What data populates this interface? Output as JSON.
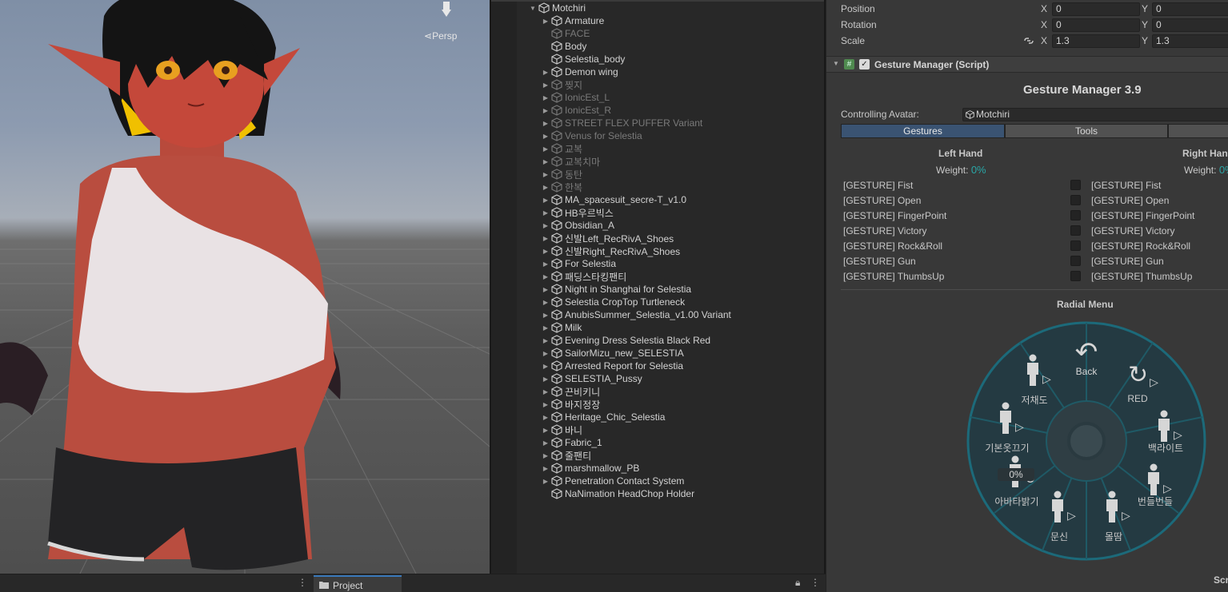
{
  "scene": {
    "persp_label": "Persp"
  },
  "hierarchy": {
    "root": "Motchiri",
    "items": [
      {
        "label": "Armature",
        "expandable": true,
        "active": true
      },
      {
        "label": "FACE",
        "expandable": false,
        "active": false
      },
      {
        "label": "Body",
        "expandable": false,
        "active": true
      },
      {
        "label": "Selestia_body",
        "expandable": false,
        "active": true
      },
      {
        "label": "Demon wing",
        "expandable": true,
        "active": true
      },
      {
        "label": "찢지",
        "expandable": true,
        "active": false
      },
      {
        "label": "IonicEst_L",
        "expandable": true,
        "active": false
      },
      {
        "label": "IonicEst_R",
        "expandable": true,
        "active": false
      },
      {
        "label": "STREET FLEX PUFFER Variant",
        "expandable": true,
        "active": false
      },
      {
        "label": "Venus for Selestia",
        "expandable": true,
        "active": false
      },
      {
        "label": "교복",
        "expandable": true,
        "active": false
      },
      {
        "label": "교복치마",
        "expandable": true,
        "active": false
      },
      {
        "label": "동탄",
        "expandable": true,
        "active": false
      },
      {
        "label": "한복",
        "expandable": true,
        "active": false
      },
      {
        "label": "MA_spacesuit_secre-T_v1.0",
        "expandable": true,
        "active": true
      },
      {
        "label": "HB우르빅스",
        "expandable": true,
        "active": true
      },
      {
        "label": "Obsidian_A",
        "expandable": true,
        "active": true
      },
      {
        "label": "신발Left_RecRivA_Shoes",
        "expandable": true,
        "active": true
      },
      {
        "label": "신발Right_RecRivA_Shoes",
        "expandable": true,
        "active": true
      },
      {
        "label": "For Selestia",
        "expandable": true,
        "active": true
      },
      {
        "label": "패딩스타킹팬티",
        "expandable": true,
        "active": true
      },
      {
        "label": "Night in Shanghai for Selestia",
        "expandable": true,
        "active": true
      },
      {
        "label": "Selestia CropTop Turtleneck",
        "expandable": true,
        "active": true
      },
      {
        "label": "AnubisSummer_Selestia_v1.00 Variant",
        "expandable": true,
        "active": true
      },
      {
        "label": "Milk",
        "expandable": true,
        "active": true
      },
      {
        "label": "Evening Dress Selestia Black Red",
        "expandable": true,
        "active": true
      },
      {
        "label": "SailorMizu_new_SELESTIA",
        "expandable": true,
        "active": true
      },
      {
        "label": "Arrested Report for Selestia",
        "expandable": true,
        "active": true
      },
      {
        "label": "SELESTIA_Pussy",
        "expandable": true,
        "active": true
      },
      {
        "label": "끈비키니",
        "expandable": true,
        "active": true
      },
      {
        "label": "바지정장",
        "expandable": true,
        "active": true
      },
      {
        "label": "Heritage_Chic_Selestia",
        "expandable": true,
        "active": true
      },
      {
        "label": "바니",
        "expandable": true,
        "active": true
      },
      {
        "label": "Fabric_1",
        "expandable": true,
        "active": true
      },
      {
        "label": "줄팬티",
        "expandable": true,
        "active": true
      },
      {
        "label": "marshmallow_PB",
        "expandable": true,
        "active": true
      },
      {
        "label": "Penetration Contact System",
        "expandable": true,
        "active": true
      },
      {
        "label": "NaNimation HeadChop Holder",
        "expandable": false,
        "active": true
      }
    ]
  },
  "inspector": {
    "transform": {
      "position_label": "Position",
      "rotation_label": "Rotation",
      "scale_label": "Scale",
      "pos_x": "0",
      "pos_y": "0",
      "rot_x": "0",
      "rot_y": "0",
      "scale_x": "1.3",
      "scale_y": "1.3",
      "x_axis": "X",
      "y_axis": "Y"
    },
    "component_title": "Gesture Manager (Script)",
    "gm_title": "Gesture Manager 3.9",
    "controlling_label": "Controlling Avatar:",
    "controlling_value": "Motchiri",
    "tabs": [
      "Gestures",
      "Tools",
      ""
    ],
    "left_hand": {
      "title": "Left Hand",
      "weight_label": "Weight:",
      "weight_value": "0%"
    },
    "right_hand": {
      "title": "Right Hand",
      "weight_label": "Weight:",
      "weight_value": "0%"
    },
    "gestures": [
      "[GESTURE] Fist",
      "[GESTURE] Open",
      "[GESTURE] FingerPoint",
      "[GESTURE] Victory",
      "[GESTURE] Rock&Roll",
      "[GESTURE] Gun",
      "[GESTURE] ThumbsUp"
    ],
    "radial_title": "Radial Menu",
    "radial": {
      "back": "Back",
      "center_value": "0%",
      "items": [
        "RED",
        "백라이트",
        "번들번들",
        "몰땀",
        "문신",
        "아바타밝기",
        "기본옷끄기",
        "저채도"
      ]
    },
    "footer_label": "Scri"
  },
  "bottom": {
    "project_tab": "Project"
  },
  "colors": {
    "accent_blue": "#3a79bb",
    "weight_teal": "#29a7a7",
    "radial_ring": "#1c5a68"
  }
}
